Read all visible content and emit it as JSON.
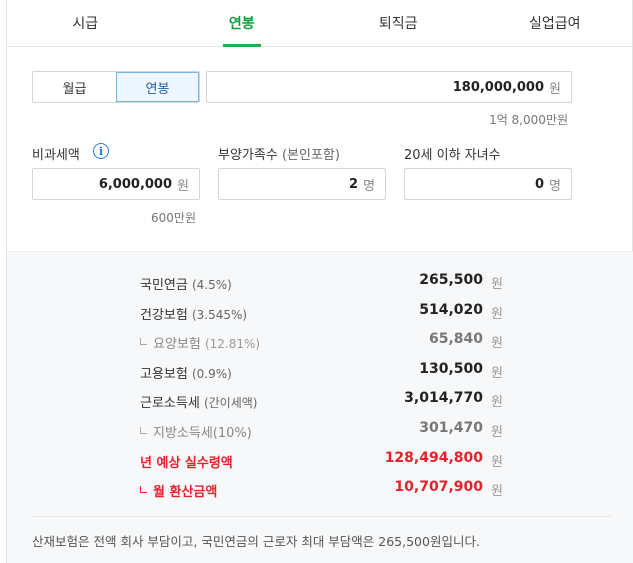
{
  "tabs": [
    "시급",
    "연봉",
    "퇴직금",
    "실업급여"
  ],
  "toggle": {
    "monthly": "월급",
    "annual": "연봉"
  },
  "salary": {
    "value": "180,000,000",
    "unit": "원",
    "hint": "1억 8,000만원"
  },
  "nontax": {
    "label": "비과세액",
    "value": "6,000,000",
    "unit": "원",
    "hint": "600만원"
  },
  "dependents": {
    "label": "부양가족수",
    "label_sub": "(본인포함)",
    "value": "2",
    "unit": "명"
  },
  "children": {
    "label": "20세 이하 자녀수",
    "value": "0",
    "unit": "명"
  },
  "won": "원",
  "results": [
    {
      "name": "국민연금",
      "pct": "(4.5%)",
      "amount": "265,500"
    },
    {
      "name": "건강보험",
      "pct": "(3.545%)",
      "amount": "514,020"
    },
    {
      "name": "요양보험",
      "pct": "(12.81%)",
      "amount": "65,840"
    },
    {
      "name": "고용보험",
      "pct": "(0.9%)",
      "amount": "130,500"
    },
    {
      "name": "근로소득세",
      "pct": "(간이세액)",
      "amount": "3,014,770"
    },
    {
      "name": "지방소득세(10%)",
      "pct": "",
      "amount": "301,470"
    },
    {
      "name": "년 예상 실수령액",
      "pct": "",
      "amount": "128,494,800"
    },
    {
      "name": "월 환산금액",
      "pct": "",
      "amount": "10,707,900"
    }
  ],
  "note": "산재보험은 전액 회사 부담이고, 국민연금의 근로자 최대 부담액은 265,500원입니다."
}
